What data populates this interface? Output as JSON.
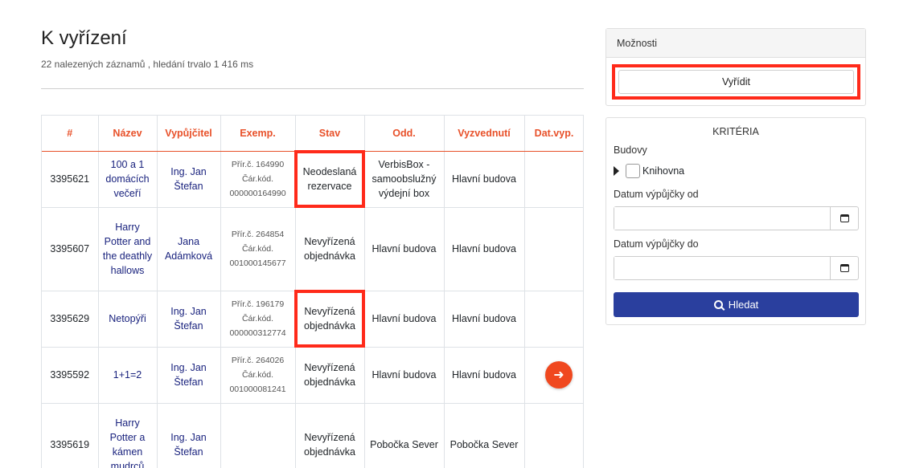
{
  "page": {
    "title": "K vyřízení",
    "subtitle": "22 nalezených záznamů , hledání trvalo 1 416 ms"
  },
  "table": {
    "headers": [
      "#",
      "Název",
      "Vypůjčitel",
      "Exemp.",
      "Stav",
      "Odd.",
      "Vyzvednutí",
      "Dat.vyp."
    ],
    "rows": [
      {
        "num": "3395621",
        "title": "100 a 1 domácích večeří",
        "reader": "Ing. Jan Štefan",
        "prir": "Přír.č. 164990",
        "car": "Čár.kód. 000000164990",
        "stav": "Neodeslaná rezervace",
        "odd": "VerbisBox - samoobslužný výdejní box",
        "vyz": "Hlavní budova",
        "highlight": true
      },
      {
        "num": "3395607",
        "title": "Harry Potter and the deathly hallows",
        "reader": "Jana Adámková",
        "prir": "Přír.č. 264854",
        "car": "Čár.kód. 001000145677",
        "stav": "Nevyřízená objednávka",
        "odd": "Hlavní budova",
        "vyz": "Hlavní budova",
        "highlight": false
      },
      {
        "num": "3395629",
        "title": "Netopýři",
        "reader": "Ing. Jan Štefan",
        "prir": "Přír.č. 196179",
        "car": "Čár.kód. 000000312774",
        "stav": "Nevyřízená objednávka",
        "odd": "Hlavní budova",
        "vyz": "Hlavní budova",
        "highlight": true
      },
      {
        "num": "3395592",
        "title": "1+1=2",
        "reader": "Ing. Jan Štefan",
        "prir": "Přír.č. 264026",
        "car": "Čár.kód. 001000081241",
        "stav": "Nevyřízená objednávka",
        "odd": "Hlavní budova",
        "vyz": "Hlavní budova",
        "highlight": false
      },
      {
        "num": "3395619",
        "title": "Harry Potter a kámen mudrců",
        "reader": "Ing. Jan Štefan",
        "prir": "",
        "car": "",
        "stav": "Nevyřízená objednávka",
        "odd": "Pobočka Sever",
        "vyz": "Pobočka Sever",
        "highlight": false
      }
    ]
  },
  "options": {
    "header": "Možnosti",
    "vyridit_label": "Vyřídit"
  },
  "criteria": {
    "title": "KRITÉRIA",
    "budovy_label": "Budovy",
    "knihovna_label": "Knihovna",
    "date_from_label": "Datum výpůjčky od",
    "date_to_label": "Datum výpůjčky do",
    "date_from_value": "",
    "date_to_value": "",
    "search_label": "Hledat"
  },
  "icons": {
    "go": "arrow-right-icon",
    "calendar": "calendar-icon",
    "search": "search-icon",
    "caret": "caret-right-icon"
  },
  "colors": {
    "accent": "#e8512a",
    "primary": "#2a3f9e",
    "link": "#1a237e",
    "highlight": "#ff2a1a"
  }
}
